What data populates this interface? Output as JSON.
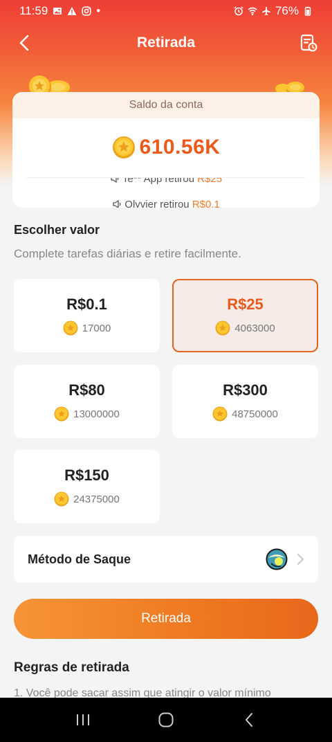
{
  "status": {
    "time": "11:59",
    "battery": "76%",
    "dot": "•"
  },
  "header": {
    "title": "Retirada"
  },
  "balance": {
    "label": "Saldo da conta",
    "value": "610.56K",
    "ticker": [
      {
        "prefix": "Te** App retirou ",
        "amount": "R$25"
      },
      {
        "prefix": "Olyvier retirou ",
        "amount": "R$0.1"
      }
    ]
  },
  "choose": {
    "title": "Escolher valor",
    "subtitle": "Complete tarefas diárias e retire facilmente."
  },
  "options": [
    {
      "amount": "R$0.1",
      "coins": "17000",
      "selected": false
    },
    {
      "amount": "R$25",
      "coins": "4063000",
      "selected": true
    },
    {
      "amount": "R$80",
      "coins": "13000000",
      "selected": false
    },
    {
      "amount": "R$300",
      "coins": "48750000",
      "selected": false
    },
    {
      "amount": "R$150",
      "coins": "24375000",
      "selected": false
    }
  ],
  "method": {
    "label": "Método de Saque",
    "icon": "payment-method-icon"
  },
  "withdraw_button": "Retirada",
  "rules": {
    "title": "Regras de retirada",
    "line1": "1. Você pode sacar assim que atingir o valor mínimo"
  },
  "colors": {
    "accent": "#ea5a1c",
    "button": "#ef7d24",
    "header": "#ee3e35"
  }
}
